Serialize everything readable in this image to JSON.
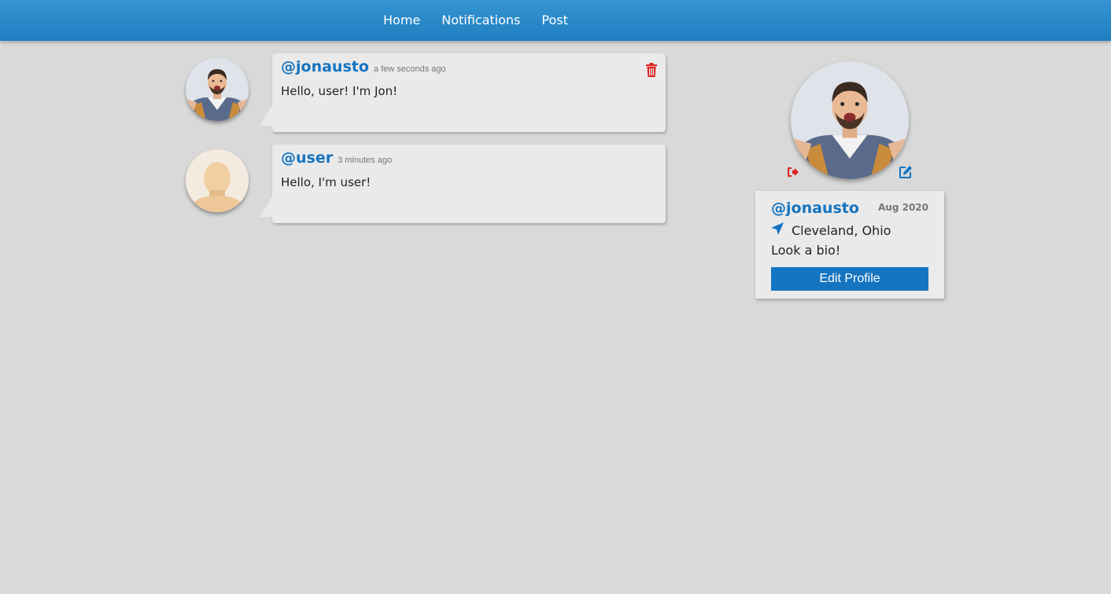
{
  "nav": {
    "items": [
      {
        "label": "Home"
      },
      {
        "label": "Notifications"
      },
      {
        "label": "Post"
      }
    ]
  },
  "posts": [
    {
      "handle": "@jonausto",
      "time": "a few seconds ago",
      "body": "Hello, user! I'm Jon!",
      "avatar": "man-photo-avatar",
      "deletable": true
    },
    {
      "handle": "@user",
      "time": "3 minutes ago",
      "body": "Hello, I'm user!",
      "avatar": "default-avatar",
      "deletable": false
    }
  ],
  "profile": {
    "handle": "@jonausto",
    "joined": "Aug 2020",
    "location": "Cleveland, Ohio",
    "bio": "Look a bio!",
    "edit_label": "Edit Profile"
  },
  "colors": {
    "brand": "#1574c0",
    "danger": "#e02020",
    "background": "#d9d9d9",
    "card": "#eaeaea"
  },
  "icons": {
    "delete": "trash-icon",
    "logout": "logout-icon",
    "edit_image": "edit-icon",
    "location": "location-arrow-icon"
  }
}
